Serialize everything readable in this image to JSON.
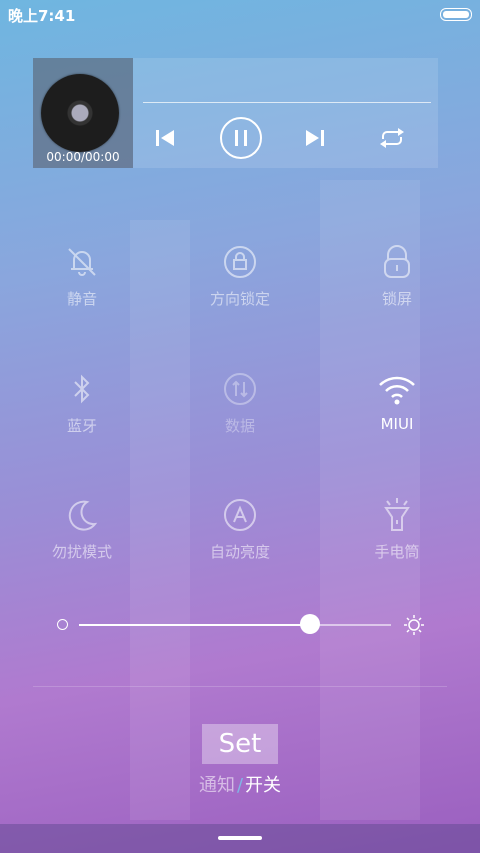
{
  "status_bar": {
    "time": "晚上7:41"
  },
  "player": {
    "time_display": "00:00/00:00"
  },
  "toggles": {
    "mute": "静音",
    "rotation_lock": "方向锁定",
    "lock_screen": "锁屏",
    "bluetooth": "蓝牙",
    "data": "数据",
    "wifi": "MIUI",
    "do_not_disturb": "勿扰模式",
    "auto_brightness": "自动亮度",
    "flashlight": "手电筒"
  },
  "brightness": {
    "level": 0.74
  },
  "footer": {
    "set_label": "Set",
    "tab_notify": "通知",
    "separator": "/",
    "tab_switches": "开关"
  }
}
